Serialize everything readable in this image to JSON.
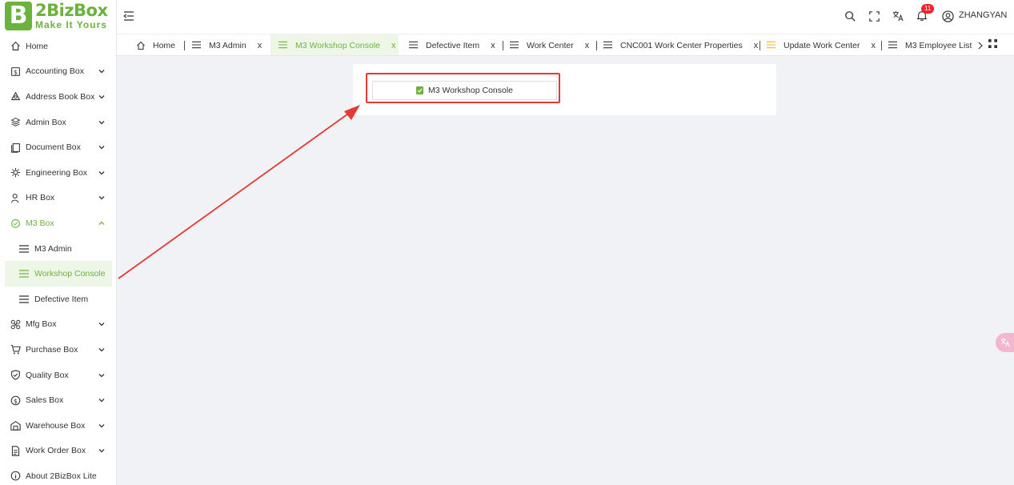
{
  "logo": {
    "name": "2BizBox",
    "tagline": "Make It Yours",
    "mark": "B"
  },
  "sidebar": {
    "items": [
      {
        "label": "Home",
        "icon": "home-icon",
        "chevron": false
      },
      {
        "label": "Accounting Box",
        "icon": "accounting-icon",
        "chevron": true
      },
      {
        "label": "Address Book Box",
        "icon": "address-book-icon",
        "chevron": true
      },
      {
        "label": "Admin Box",
        "icon": "admin-icon",
        "chevron": true
      },
      {
        "label": "Document Box",
        "icon": "document-icon",
        "chevron": true
      },
      {
        "label": "Engineering Box",
        "icon": "engineering-icon",
        "chevron": true
      },
      {
        "label": "HR Box",
        "icon": "hr-icon",
        "chevron": true
      },
      {
        "label": "M3 Box",
        "icon": "m3-icon",
        "chevron": true,
        "expanded": true
      },
      {
        "label": "M3 Admin",
        "icon": "menu-icon",
        "sub": true
      },
      {
        "label": "Workshop Console",
        "icon": "menu-icon",
        "sub": true,
        "selected": true
      },
      {
        "label": "Defective Item",
        "icon": "menu-icon",
        "sub": true
      },
      {
        "label": "Mfg Box",
        "icon": "mfg-icon",
        "chevron": true
      },
      {
        "label": "Purchase Box",
        "icon": "purchase-icon",
        "chevron": true
      },
      {
        "label": "Quality Box",
        "icon": "quality-icon",
        "chevron": true
      },
      {
        "label": "Sales Box",
        "icon": "sales-icon",
        "chevron": true
      },
      {
        "label": "Warehouse Box",
        "icon": "warehouse-icon",
        "chevron": true
      },
      {
        "label": "Work Order Box",
        "icon": "work-order-icon",
        "chevron": true
      },
      {
        "label": "About 2BizBox Lite",
        "icon": "info-icon",
        "chevron": false
      }
    ]
  },
  "header": {
    "notification_count": "11",
    "user": "ZHANGYAN"
  },
  "tabs": [
    {
      "label": "Home"
    },
    {
      "label": "M3 Admin",
      "close": "x"
    },
    {
      "label": "M3 Workshop Console",
      "close": "x",
      "active": true
    },
    {
      "label": "Defective Item",
      "close": "x"
    },
    {
      "label": "Work Center",
      "close": "x"
    },
    {
      "label": "CNC001 Work Center Properties",
      "close": "x"
    },
    {
      "label": "Update Work Center",
      "close": "x"
    },
    {
      "label": "M3 Employee List"
    }
  ],
  "main": {
    "console_button_label": "M3 Workshop Console"
  },
  "colors": {
    "accent": "#6cb33e",
    "highlight": "#e53935",
    "badge": "#f5222d"
  }
}
